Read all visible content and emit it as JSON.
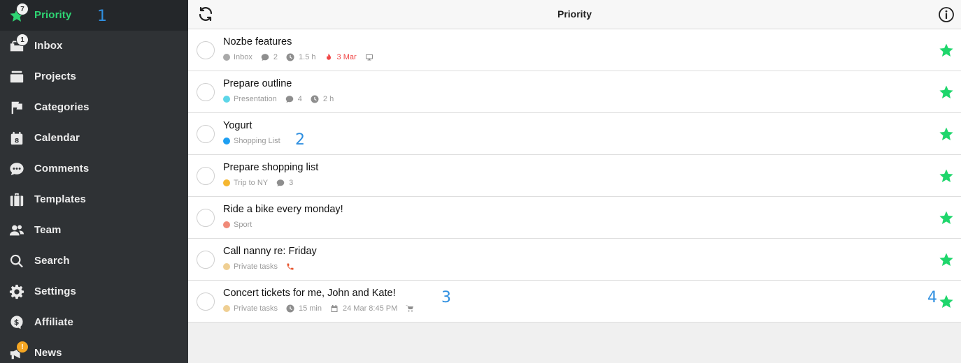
{
  "sidebar": {
    "items": [
      {
        "label": "Priority",
        "icon": "star-icon",
        "badge": "7",
        "active": true
      },
      {
        "label": "Inbox",
        "icon": "inbox-icon",
        "badge": "1"
      },
      {
        "label": "Projects",
        "icon": "projects-icon"
      },
      {
        "label": "Categories",
        "icon": "flag-icon"
      },
      {
        "label": "Calendar",
        "icon": "calendar-icon",
        "icon_text": "8"
      },
      {
        "label": "Comments",
        "icon": "comment-icon"
      },
      {
        "label": "Templates",
        "icon": "templates-icon"
      },
      {
        "label": "Team",
        "icon": "team-icon"
      },
      {
        "label": "Search",
        "icon": "search-icon"
      },
      {
        "label": "Settings",
        "icon": "gear-icon"
      },
      {
        "label": "Affiliate",
        "icon": "dollar-icon"
      },
      {
        "label": "News",
        "icon": "megaphone-icon",
        "badge": "!"
      }
    ]
  },
  "header": {
    "title": "Priority",
    "refresh_icon": "refresh-icon",
    "info_icon": "info-icon"
  },
  "annotations": [
    "1",
    "2",
    "3",
    "4"
  ],
  "colors": {
    "sidebar_bg": "#2f3235",
    "accent_green": "#2ed573",
    "star_green": "#1ed66b",
    "due_red": "#f04646"
  },
  "tasks": [
    {
      "title": "Nozbe features",
      "project": "Inbox",
      "project_color": "#a9a9a9",
      "comments": "2",
      "time": "1.5 h",
      "due": "3 Mar",
      "extra_icon": "monitor-icon"
    },
    {
      "title": "Prepare outline",
      "project": "Presentation",
      "project_color": "#5dd6e8",
      "comments": "4",
      "time": "2 h"
    },
    {
      "title": "Yogurt",
      "project": "Shopping List",
      "project_color": "#1e9ff2"
    },
    {
      "title": "Prepare shopping list",
      "project": "Trip to NY",
      "project_color": "#f5b731",
      "comments": "3"
    },
    {
      "title": "Ride a bike every monday!",
      "project": "Sport",
      "project_color": "#f08a78"
    },
    {
      "title": "Call nanny re: Friday",
      "project": "Private tasks",
      "project_color": "#efcf93",
      "extra_icon": "phone-icon"
    },
    {
      "title": "Concert tickets for me, John and Kate!",
      "project": "Private tasks",
      "project_color": "#efcf93",
      "time": "15 min",
      "date": "24 Mar 8:45 PM",
      "extra_icon": "cart-icon"
    }
  ]
}
